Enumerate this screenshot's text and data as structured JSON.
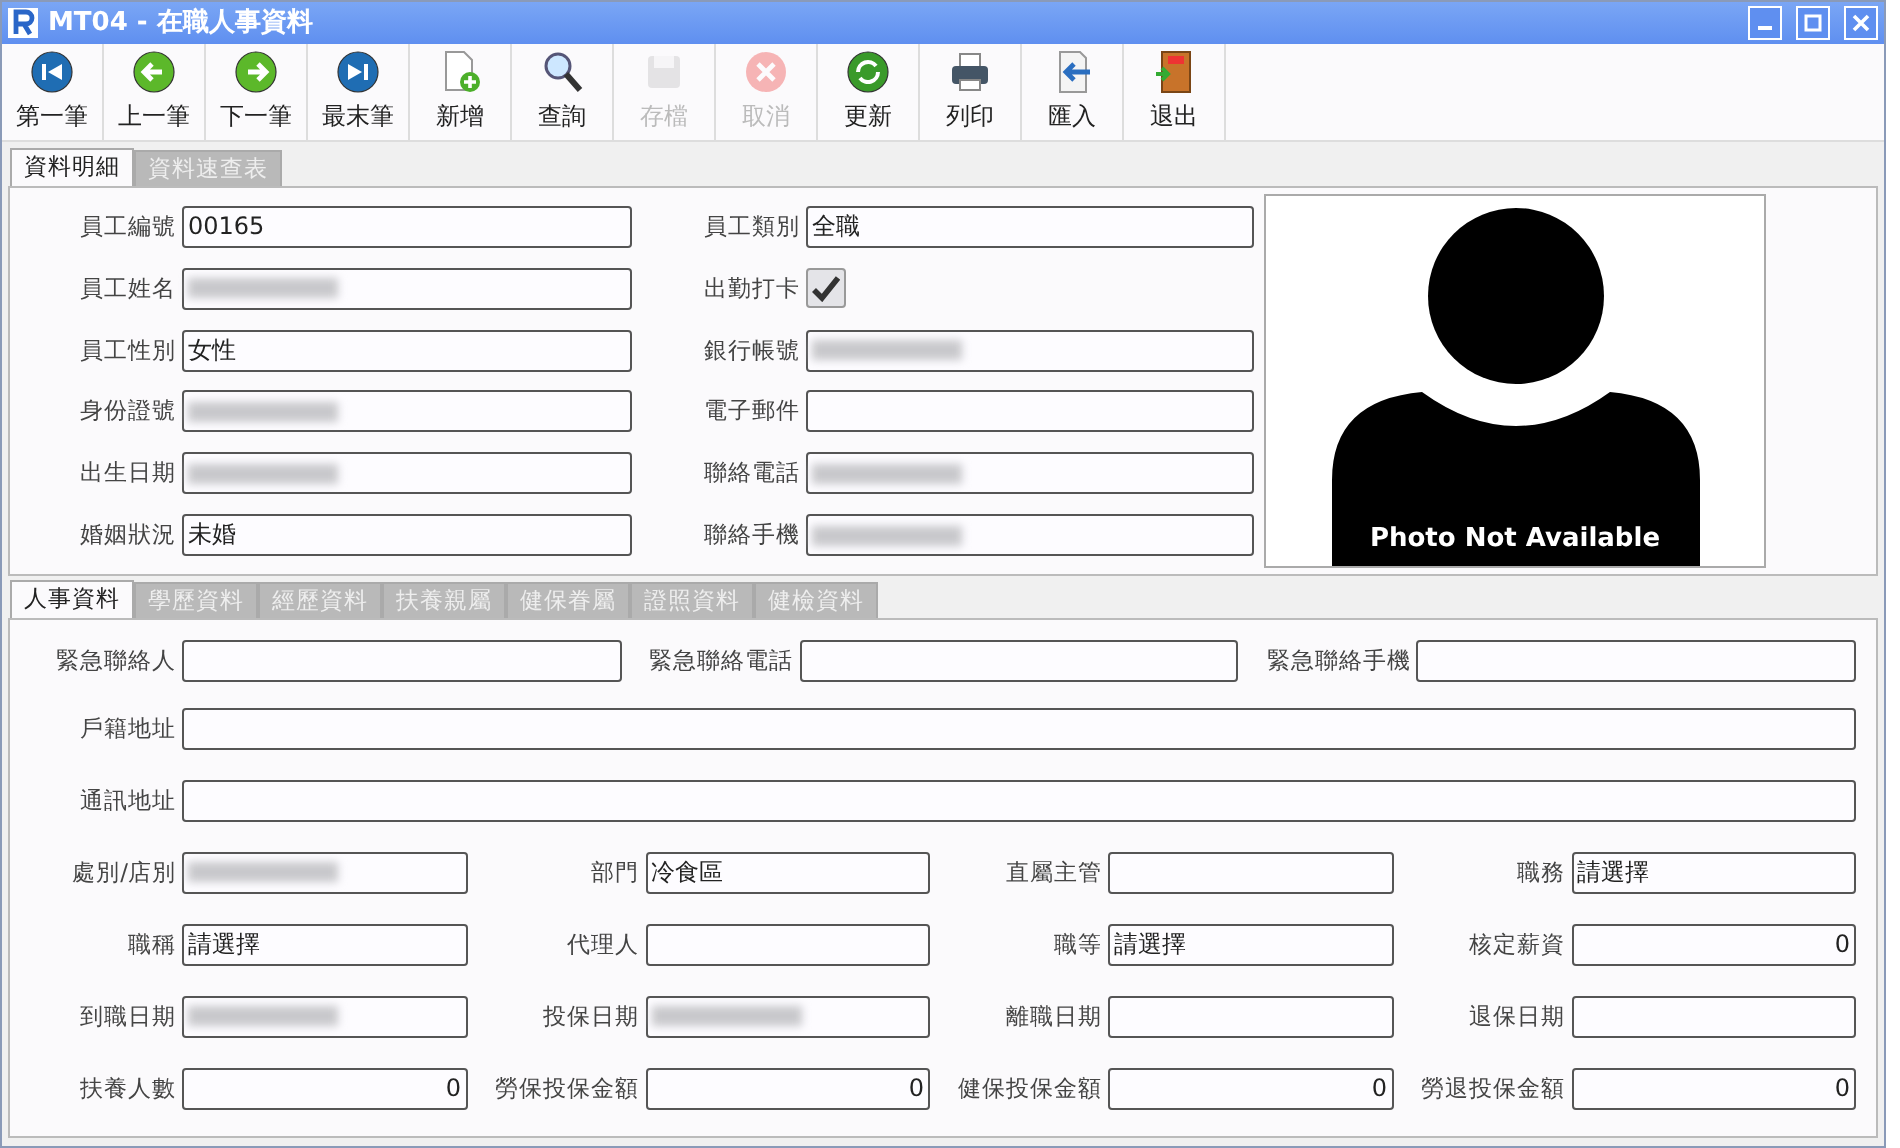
{
  "window": {
    "title": "MT04 - 在職人事資料"
  },
  "toolbar": [
    {
      "kind": "first",
      "label": "第一筆",
      "disabled": false
    },
    {
      "kind": "prev",
      "label": "上一筆",
      "disabled": false
    },
    {
      "kind": "next",
      "label": "下一筆",
      "disabled": false
    },
    {
      "kind": "last",
      "label": "最末筆",
      "disabled": false
    },
    {
      "kind": "new",
      "label": "新增",
      "disabled": false
    },
    {
      "kind": "search",
      "label": "查詢",
      "disabled": false
    },
    {
      "kind": "save",
      "label": "存檔",
      "disabled": true
    },
    {
      "kind": "cancel",
      "label": "取消",
      "disabled": true
    },
    {
      "kind": "refresh",
      "label": "更新",
      "disabled": false
    },
    {
      "kind": "print",
      "label": "列印",
      "disabled": false
    },
    {
      "kind": "import",
      "label": "匯入",
      "disabled": false
    },
    {
      "kind": "exit",
      "label": "退出",
      "disabled": false
    }
  ],
  "main_tabs": [
    {
      "label": "資料明細",
      "selected": true
    },
    {
      "label": "資料速查表",
      "selected": false
    }
  ],
  "details": {
    "left": [
      {
        "kind": "text",
        "label": "員工編號",
        "value": "00165"
      },
      {
        "kind": "text",
        "label": "員工姓名",
        "blurred": true
      },
      {
        "kind": "text",
        "label": "員工性別",
        "value": "女性"
      },
      {
        "kind": "text",
        "label": "身份證號",
        "blurred": true
      },
      {
        "kind": "text",
        "label": "出生日期",
        "blurred": true
      },
      {
        "kind": "text",
        "label": "婚姻狀況",
        "value": "未婚"
      }
    ],
    "right": [
      {
        "kind": "text",
        "label": "員工類別",
        "value": "全職"
      },
      {
        "kind": "checkbox",
        "label": "出勤打卡",
        "checked": true
      },
      {
        "kind": "text",
        "label": "銀行帳號",
        "blurred": true
      },
      {
        "kind": "text",
        "label": "電子郵件"
      },
      {
        "kind": "text",
        "label": "聯絡電話",
        "blurred": true
      },
      {
        "kind": "text",
        "label": "聯絡手機",
        "blurred": true
      }
    ],
    "photo": {
      "caption": "Photo Not Available"
    }
  },
  "sub_tabs": [
    {
      "label": "人事資料",
      "selected": true
    },
    {
      "label": "學歷資料",
      "selected": false
    },
    {
      "label": "經歷資料",
      "selected": false
    },
    {
      "label": "扶養親屬",
      "selected": false
    },
    {
      "label": "健保眷屬",
      "selected": false
    },
    {
      "label": "證照資料",
      "selected": false
    },
    {
      "label": "健檢資料",
      "selected": false
    }
  ],
  "personnel": {
    "rows": [
      [
        {
          "kind": "text",
          "label": "緊急聯絡人"
        },
        {
          "kind": "text",
          "label": "緊急聯絡電話"
        },
        {
          "kind": "text",
          "label": "緊急聯絡手機"
        }
      ],
      [
        {
          "kind": "text",
          "label": "戶籍地址"
        }
      ],
      [
        {
          "kind": "text",
          "label": "通訊地址"
        }
      ],
      [
        {
          "kind": "text",
          "label": "處別/店別",
          "blurred": true
        },
        {
          "kind": "text",
          "label": "部門",
          "value": "冷食區"
        },
        {
          "kind": "text",
          "label": "直屬主管"
        },
        {
          "kind": "text",
          "label": "職務",
          "value": "請選擇"
        }
      ],
      [
        {
          "kind": "text",
          "label": "職稱",
          "value": "請選擇"
        },
        {
          "kind": "text",
          "label": "代理人"
        },
        {
          "kind": "text",
          "label": "職等",
          "value": "請選擇"
        },
        {
          "kind": "number",
          "label": "核定薪資",
          "value": "0"
        }
      ],
      [
        {
          "kind": "text",
          "label": "到職日期",
          "blurred": true
        },
        {
          "kind": "text",
          "label": "投保日期",
          "blurred": true
        },
        {
          "kind": "text",
          "label": "離職日期"
        },
        {
          "kind": "text",
          "label": "退保日期"
        }
      ],
      [
        {
          "kind": "number",
          "label": "扶養人數",
          "value": "0"
        },
        {
          "kind": "number",
          "label": "勞保投保金額",
          "value": "0"
        },
        {
          "kind": "number",
          "label": "健保投保金額",
          "value": "0"
        },
        {
          "kind": "number",
          "label": "勞退投保金額",
          "value": "0"
        }
      ]
    ]
  }
}
